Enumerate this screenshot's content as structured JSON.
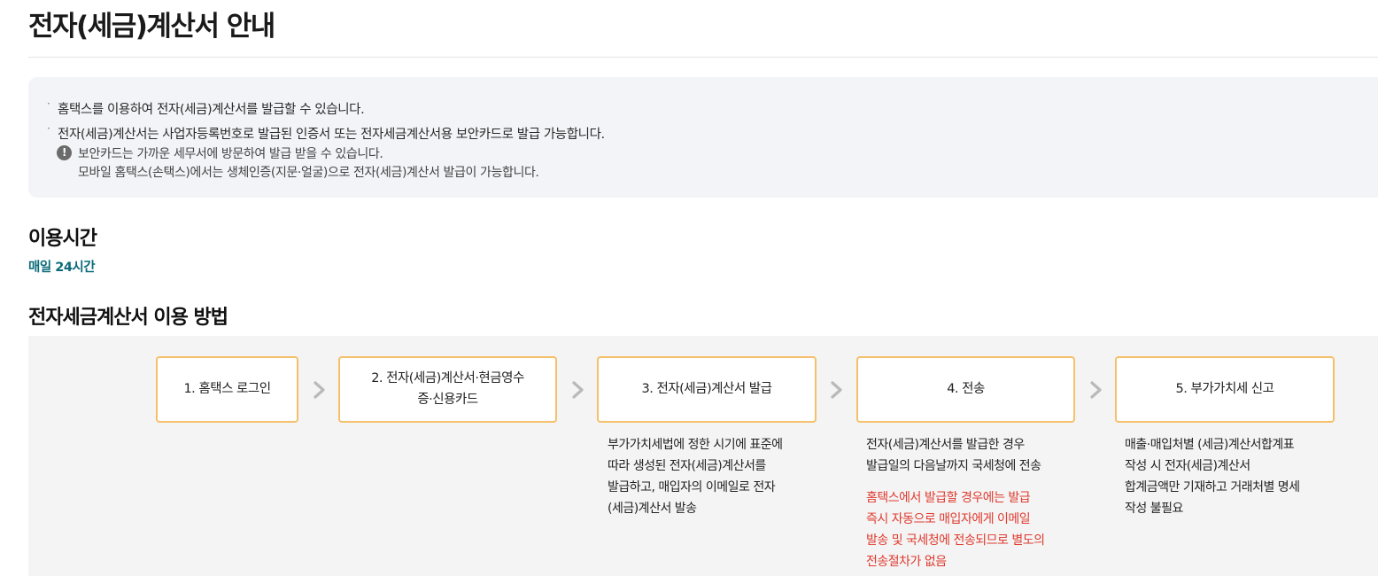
{
  "page": {
    "title": "전자(세금)계산서 안내"
  },
  "info": {
    "bullets": [
      "홈택스를 이용하여 전자(세금)계산서를 발급할 수 있습니다.",
      "전자(세금)계산서는 사업자등록번호로 발급된 인증서 또는 전자세금계산서용 보안카드로 발급 가능합니다."
    ],
    "note_icon": "exclamation-circle-icon",
    "note_lines": [
      "보안카드는 가까운 세무서에 방문하여 발급 받을 수 있습니다.",
      "모바일 홈택스(손택스)에서는 생체인증(지문·얼굴)으로 전자(세금)계산서 발급이 가능합니다."
    ]
  },
  "usage": {
    "heading": "이용시간",
    "value": "매일 24시간"
  },
  "method": {
    "heading": "전자세금계산서 이용 방법",
    "arrow_icon": "chevron-right-icon",
    "steps": [
      {
        "label_line1": "1. 홈택스 로그인",
        "label_line2": ""
      },
      {
        "label_line1": "2. 전자(세금)계산서·현금영수",
        "label_line2": "증·신용카드"
      },
      {
        "label_line1": "3. 전자(세금)계산서 발급",
        "label_line2": ""
      },
      {
        "label_line1": "4. 전송",
        "label_line2": ""
      },
      {
        "label_line1": "5. 부가가치세 신고",
        "label_line2": ""
      }
    ],
    "step3_desc": [
      "부가가치세법에 정한 시기에 표준에",
      "따라 생성된 전자(세금)계산서를",
      "발급하고, 매입자의 이메일로 전자",
      "(세금)계산서 발송"
    ],
    "step4_desc": [
      "전자(세금)계산서를 발급한 경우",
      "발급일의 다음날까지 국세청에 전송"
    ],
    "step4_note": [
      "홈택스에서 발급할 경우에는 발급",
      "즉시 자동으로 매입자에게 이메일",
      "발송 및 국세청에 전송되므로 별도의",
      "전송절차가 없음"
    ],
    "step5_desc": [
      "매출·매입처별 (세금)계산서합계표",
      "작성 시 전자(세금)계산서",
      "합계금액만 기재하고 거래처별 명세",
      "작성 불필요"
    ]
  },
  "colors": {
    "accent_teal": "#0b6b7a",
    "step_border": "#f5c06b",
    "note_red": "#e03a2f",
    "info_bg": "#f2f4f8",
    "flow_bg": "#f4f4f4"
  }
}
